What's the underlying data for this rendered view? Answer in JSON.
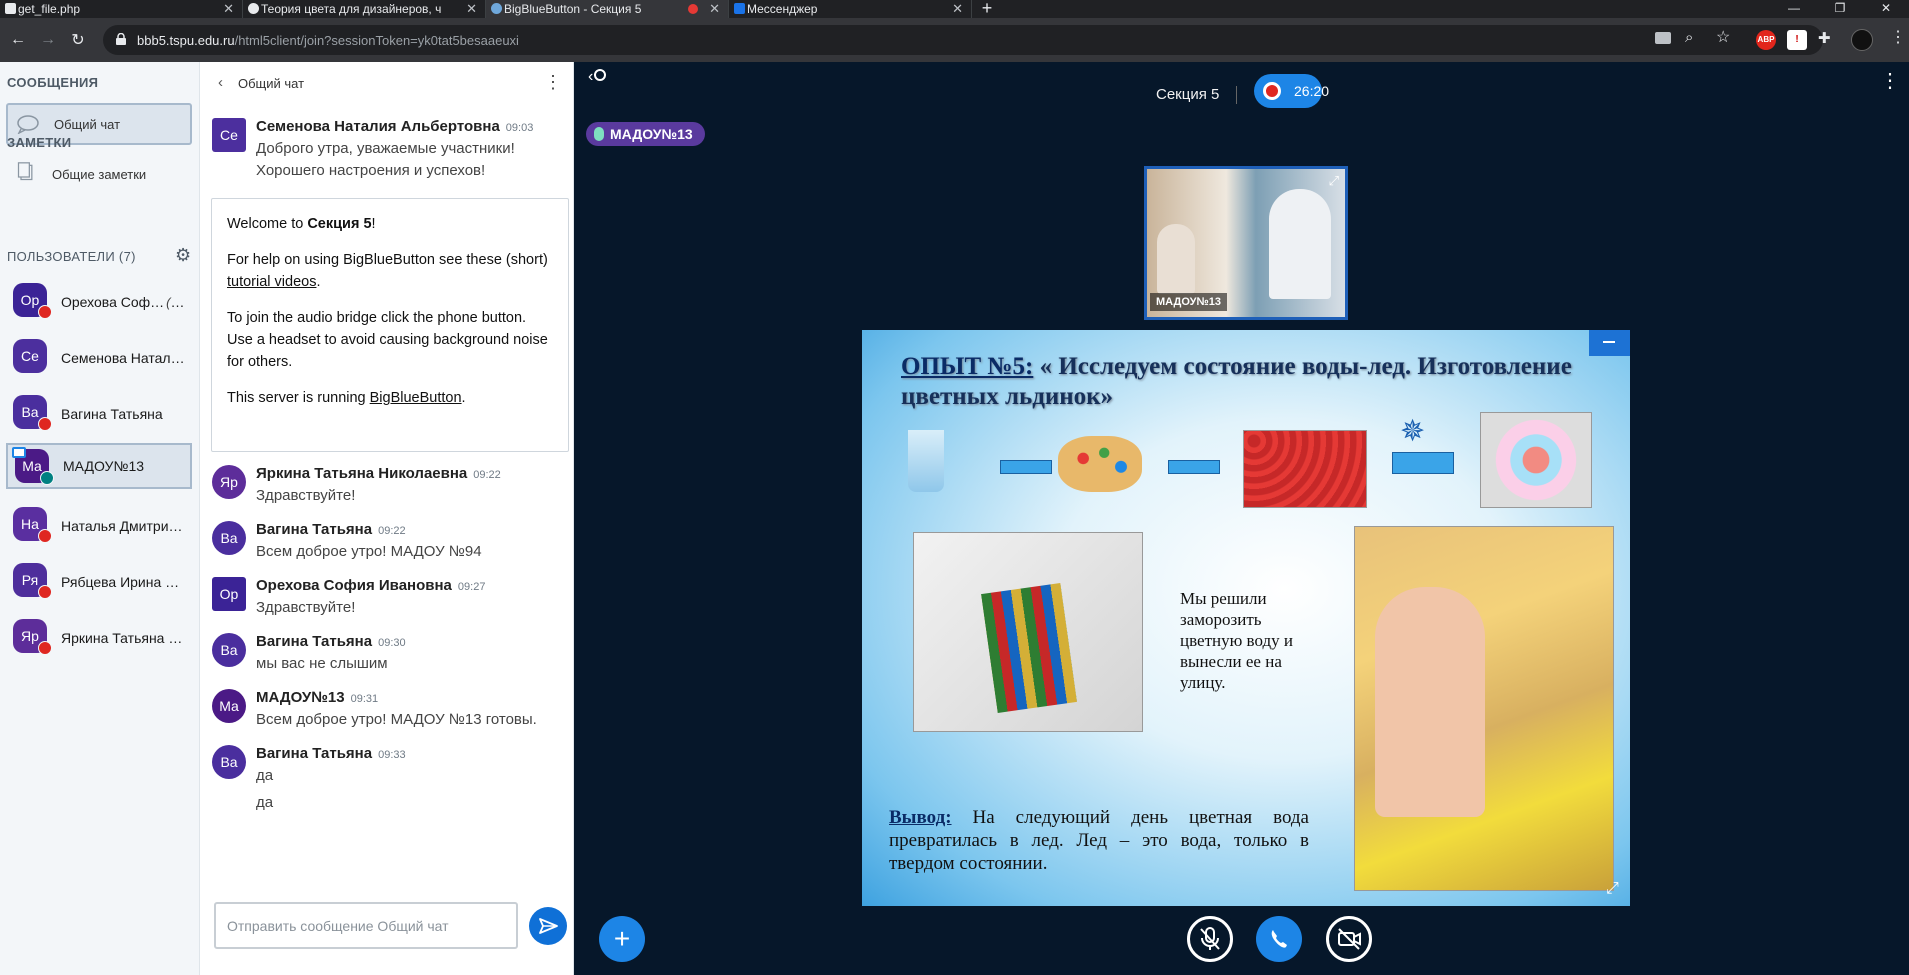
{
  "browser": {
    "tabs": [
      {
        "title": "get_file.php",
        "active": false
      },
      {
        "title": "Теория цвета для дизайнеров, ч",
        "active": false
      },
      {
        "title": "BigBlueButton - Секция 5",
        "active": true
      },
      {
        "title": "Мессенджер",
        "active": false
      }
    ],
    "url_host": "bbb5.tspu.edu.ru",
    "url_path": "/html5client/join?sessionToken=yk0tat5besaaeuxi",
    "extensions": [
      "ABP"
    ]
  },
  "sidebar": {
    "messages_header": "СООБЩЕНИЯ",
    "public_chat": "Общий чат",
    "notes_header": "ЗАМЕТКИ",
    "shared_notes": "Общие заметки",
    "users_header": "ПОЛЬЗОВАТЕЛИ (7)",
    "you_label": "(Вы)",
    "users": [
      {
        "initials": "Ор",
        "name": "Орехова Соф…",
        "color": "#3b2396",
        "you": true,
        "muted": true,
        "selected": false
      },
      {
        "initials": "Се",
        "name": "Семенова Натали…",
        "color": "#4c2f9e",
        "you": false,
        "muted": false,
        "selected": false
      },
      {
        "initials": "Ва",
        "name": "Вагина Татьяна",
        "color": "#4a2e9e",
        "you": false,
        "muted": true,
        "selected": false
      },
      {
        "initials": "Ма",
        "name": "МАДОУ№13",
        "color": "#4b1a86",
        "you": false,
        "muted": false,
        "talking": true,
        "selected": true
      },
      {
        "initials": "На",
        "name": "Наталья Дмитрие…",
        "color": "#5a2fa0",
        "you": false,
        "muted": true,
        "selected": false
      },
      {
        "initials": "Ря",
        "name": "Рябцева Ирина Ни…",
        "color": "#4e2e9c",
        "you": false,
        "muted": true,
        "selected": false
      },
      {
        "initials": "Яр",
        "name": "Яркина Татьяна Н…",
        "color": "#5d2d9a",
        "you": false,
        "muted": true,
        "selected": false
      }
    ]
  },
  "chat": {
    "title": "Общий чат",
    "welcome": {
      "line1_prefix": "Welcome to ",
      "line1_bold": "Секция 5",
      "line1_suffix": "!",
      "help_prefix": "For help on using BigBlueButton see these (short) ",
      "help_link": "tutorial videos",
      "help_suffix": ".",
      "audio": "To join the audio bridge click the phone button. Use a headset to avoid causing background noise for others.",
      "server_prefix": "This server is running ",
      "server_link": "BigBlueButton",
      "server_suffix": "."
    },
    "messages": [
      {
        "initials": "Се",
        "color": "#4c2f9e",
        "name": "Семенова Наталия Альбертовна",
        "time": "09:03",
        "lines": [
          "Доброго утра, уважаемые участники!",
          "Хорошего настроения и успехов!"
        ]
      },
      {
        "initials": "Яр",
        "color": "#5d2d9a",
        "name": "Яркина Татьяна Николаевна",
        "time": "09:22",
        "lines": [
          "Здравствуйте!"
        ]
      },
      {
        "initials": "Ва",
        "color": "#4a2e9e",
        "name": "Вагина Татьяна",
        "time": "09:22",
        "lines": [
          "Всем доброе утро! МАДОУ №94"
        ]
      },
      {
        "initials": "Ор",
        "color": "#3b2396",
        "name": "Орехова София Ивановна",
        "time": "09:27",
        "lines": [
          "Здравствуйте!"
        ]
      },
      {
        "initials": "Ва",
        "color": "#4a2e9e",
        "name": "Вагина Татьяна",
        "time": "09:30",
        "lines": [
          "мы вас не слышим"
        ]
      },
      {
        "initials": "Ма",
        "color": "#4b1a86",
        "name": "МАДОУ№13",
        "time": "09:31",
        "lines": [
          "Всем доброе утро! МАДОУ №13 готовы."
        ]
      },
      {
        "initials": "Ва",
        "color": "#4a2e9e",
        "name": "Вагина Татьяна",
        "time": "09:33",
        "lines": [
          "да",
          "да"
        ]
      }
    ],
    "input_placeholder": "Отправить сообщение Общий чат"
  },
  "meeting": {
    "section_title": "Секция 5",
    "recording_time": "26:20",
    "talking_indicator": "МАДОУ№13",
    "video_user": "МАДОУ№13",
    "accent_color": "#1d85e6"
  },
  "slide": {
    "title_underlined": "ОПЫТ №5:",
    "title_rest": " « Исследуем состояние воды-лед. Изготовление цветных льдинок»",
    "body": "Мы решили заморозить цветную воду и вынесли ее на улицу.",
    "conclusion_label": "Вывод:",
    "conclusion_text": " На следующий день цветная вода превратилась в лед. Лед – это вода, только в твердом состоянии."
  }
}
